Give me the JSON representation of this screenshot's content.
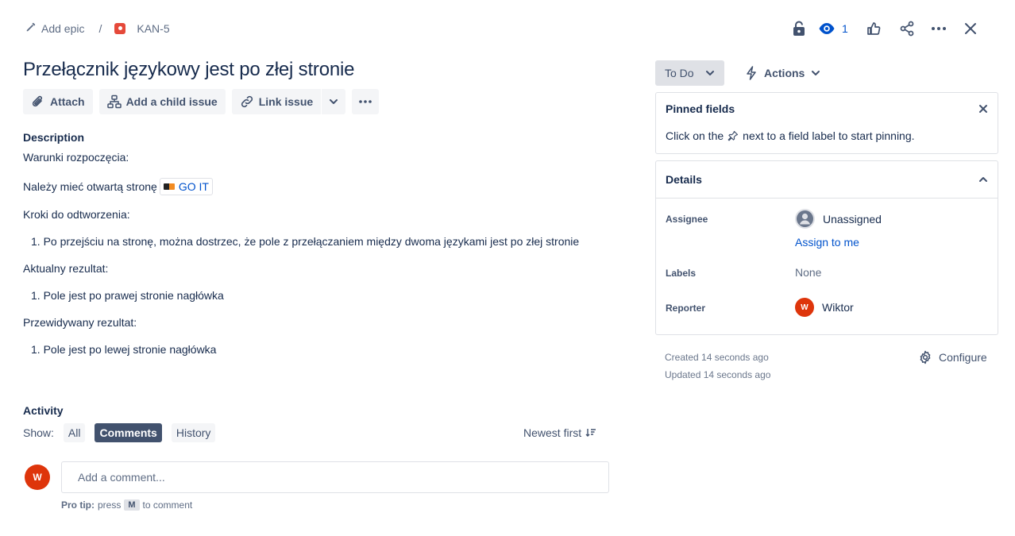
{
  "breadcrumb": {
    "add_epic": "Add epic",
    "separator": "/",
    "issue_key": "KAN-5"
  },
  "top_actions": {
    "watch_count": "1"
  },
  "issue": {
    "title": "Przełącznik językowy jest po złej stronie"
  },
  "toolbar": {
    "attach": "Attach",
    "add_child": "Add a child issue",
    "link_issue": "Link issue"
  },
  "description": {
    "heading": "Description",
    "start_conditions": "Warunki rozpoczęcia:",
    "need_page_text": "Należy mieć otwartą stronę",
    "link_text": "GO IT",
    "steps_heading": "Kroki do odtworzenia:",
    "step1": "1. Po przejściu na stronę, można dostrzec, że pole z przełączaniem między dwoma językami jest po złej stronie",
    "actual_heading": "Aktualny rezultat:",
    "actual1": "1. Pole jest po prawej stronie nagłówka",
    "expected_heading": "Przewidywany rezultat:",
    "expected1": "1. Pole jest po lewej stronie nagłówka"
  },
  "activity": {
    "heading": "Activity",
    "show_label": "Show:",
    "filters": [
      "All",
      "Comments",
      "History"
    ],
    "active_filter": "Comments",
    "sort": "Newest first",
    "comment_placeholder": "Add a comment...",
    "protip_label": "Pro tip:",
    "protip_press": "press",
    "protip_key": "M",
    "protip_suffix": "to comment",
    "avatar_initial": "W"
  },
  "status": {
    "label": "To Do",
    "actions_label": "Actions"
  },
  "pinned": {
    "title": "Pinned fields",
    "hint_prefix": "Click on the",
    "hint_suffix": "next to a field label to start pinning."
  },
  "details": {
    "title": "Details",
    "assignee_label": "Assignee",
    "assignee_value": "Unassigned",
    "assign_to_me": "Assign to me",
    "labels_label": "Labels",
    "labels_value": "None",
    "reporter_label": "Reporter",
    "reporter_value": "Wiktor",
    "reporter_initial": "W"
  },
  "meta": {
    "created": "Created 14 seconds ago",
    "updated": "Updated 14 seconds ago",
    "configure": "Configure"
  },
  "colors": {
    "primary_link": "#0052cc",
    "avatar": "#de350b",
    "text": "#172b4d"
  }
}
